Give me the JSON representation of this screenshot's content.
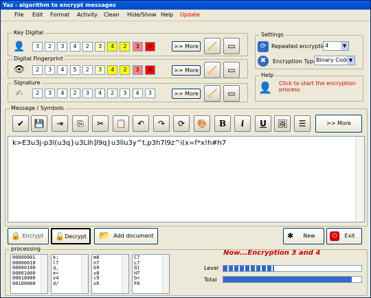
{
  "window": {
    "title": "Yaz - algorithm to encrypt messages"
  },
  "menu": [
    "File",
    "Edit",
    "Format",
    "Activity",
    "Clean",
    "Hide/Show",
    "Help",
    "Update"
  ],
  "key_digital": {
    "label": "Key Digital",
    "cells": [
      "3",
      "2",
      "3",
      "4",
      "2",
      "3",
      "4",
      "2",
      "3",
      "4"
    ],
    "colors": [
      "#ffffff",
      "#ffffff",
      "#ffffff",
      "#ffffff",
      "#ffffff",
      "#ffffc0",
      "#ffff00",
      "#ffff00",
      "#ff8080",
      "#ff0000"
    ],
    "more": ">> More"
  },
  "digital_fingerprint": {
    "label": "Digital Fingerprint",
    "cells": [
      "2",
      "3",
      "4",
      "5",
      "2",
      "3",
      "4",
      "2",
      "3",
      "4"
    ],
    "colors": [
      "#ffffff",
      "#ffffff",
      "#ffffff",
      "#ffffff",
      "#ffffff",
      "#ffffc0",
      "#ffff00",
      "#ffff00",
      "#ff8080",
      "#ff0000"
    ],
    "more": ">> More"
  },
  "signature": {
    "label": "Signature",
    "cells": [
      "2",
      "3",
      "4",
      "2",
      "3",
      "4",
      "2",
      "3",
      "4",
      "3"
    ],
    "more": ">> More"
  },
  "settings": {
    "label": "Settings",
    "repeated_label": "Repeated encryption",
    "repeated_value": "4",
    "type_label": "Encryption Type",
    "type_value": "Binary Code"
  },
  "help": {
    "label": "Help",
    "text": "Click to start the encryption process"
  },
  "message": {
    "label": "Message / Symbols",
    "more": ">> More",
    "content": "k>E3u3j-p3l(u3q}u3Llh]l9q}u3llu3y^t,p3h7l9z^i(x=f*x!h#h7"
  },
  "actions": {
    "encrypt": "Encrypt",
    "decrypt": "Decrypt",
    "add_document": "Add document",
    "new": "New",
    "exit": "Exit"
  },
  "processing": {
    "label": "processing",
    "list1": [
      "00000001",
      "00000010",
      "00000100",
      "00001000",
      "00010000",
      "00100000"
    ],
    "list2": [
      "k;",
      "l7",
      "q,",
      "e>",
      "v4",
      "d/"
    ],
    "list3": [
      "m8",
      "n7",
      "b9",
      "v8",
      "c9",
      "x6"
    ],
    "list4": [
      "C7",
      "L7",
      "Q}",
      "H7",
      "G<",
      "F6"
    ],
    "status": "Now...Encryption 3 and 4",
    "level_label": "Level",
    "total_label": "Total",
    "level_percent": 0.37,
    "total_percent": 0.93
  },
  "colors": {
    "accent": "#3169c6",
    "status": "#d40000"
  }
}
